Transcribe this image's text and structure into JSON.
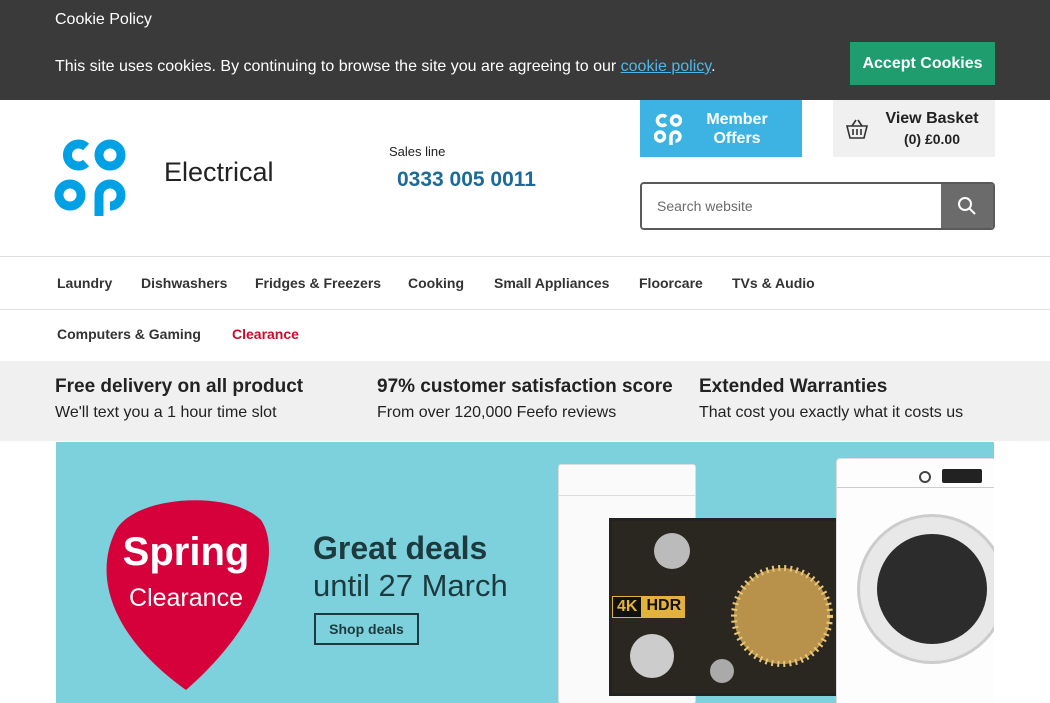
{
  "cookie": {
    "title": "Cookie Policy",
    "text_before": "This site uses cookies. By continuing to browse the site you are agreeing to our ",
    "link": "cookie policy",
    "text_after": ".",
    "accept_label": "Accept Cookies"
  },
  "header": {
    "brand_sub": "Electrical",
    "sales_label": "Sales line",
    "sales_number": "0333 005 0011",
    "member_label_1": "Member",
    "member_label_2": "Offers",
    "basket_title": "View Basket",
    "basket_value": "(0) £0.00",
    "search_placeholder": "Search website"
  },
  "nav": {
    "row1": [
      "Laundry",
      "Dishwashers",
      "Fridges & Freezers",
      "Cooking",
      "Small Appliances",
      "Floorcare",
      "TVs & Audio"
    ],
    "row2": [
      "Computers & Gaming",
      "Clearance"
    ]
  },
  "usp": [
    {
      "title": "Free delivery on all product",
      "sub": "We'll text you a 1 hour time slot"
    },
    {
      "title": "97% customer satisfaction score",
      "sub": "From over 120,000 Feefo reviews"
    },
    {
      "title": "Extended Warranties",
      "sub": "That cost you exactly what it costs us"
    }
  ],
  "hero": {
    "badge_1": "Spring",
    "badge_2": "Clearance",
    "deal_1": "Great deals",
    "deal_2": "until 27 March",
    "cta": "Shop deals",
    "tv_badge_a": "4K",
    "tv_badge_b": "HDR"
  },
  "colors": {
    "brand_blue": "#00a1e4",
    "member_bg": "#3cb3e3",
    "accept_green": "#1f9d6f",
    "clearance_red": "#cc0c2f",
    "hero_bg": "#7dd1dc",
    "badge_red": "#d6003b"
  }
}
